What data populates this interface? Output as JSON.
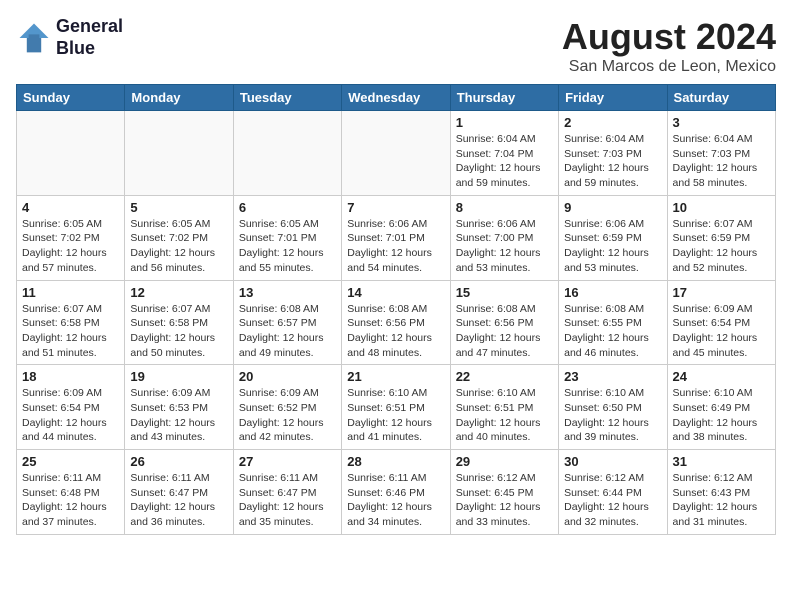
{
  "logo": {
    "line1": "General",
    "line2": "Blue"
  },
  "title": "August 2024",
  "subtitle": "San Marcos de Leon, Mexico",
  "weekdays": [
    "Sunday",
    "Monday",
    "Tuesday",
    "Wednesday",
    "Thursday",
    "Friday",
    "Saturday"
  ],
  "weeks": [
    [
      {
        "day": "",
        "info": ""
      },
      {
        "day": "",
        "info": ""
      },
      {
        "day": "",
        "info": ""
      },
      {
        "day": "",
        "info": ""
      },
      {
        "day": "1",
        "info": "Sunrise: 6:04 AM\nSunset: 7:04 PM\nDaylight: 12 hours\nand 59 minutes."
      },
      {
        "day": "2",
        "info": "Sunrise: 6:04 AM\nSunset: 7:03 PM\nDaylight: 12 hours\nand 59 minutes."
      },
      {
        "day": "3",
        "info": "Sunrise: 6:04 AM\nSunset: 7:03 PM\nDaylight: 12 hours\nand 58 minutes."
      }
    ],
    [
      {
        "day": "4",
        "info": "Sunrise: 6:05 AM\nSunset: 7:02 PM\nDaylight: 12 hours\nand 57 minutes."
      },
      {
        "day": "5",
        "info": "Sunrise: 6:05 AM\nSunset: 7:02 PM\nDaylight: 12 hours\nand 56 minutes."
      },
      {
        "day": "6",
        "info": "Sunrise: 6:05 AM\nSunset: 7:01 PM\nDaylight: 12 hours\nand 55 minutes."
      },
      {
        "day": "7",
        "info": "Sunrise: 6:06 AM\nSunset: 7:01 PM\nDaylight: 12 hours\nand 54 minutes."
      },
      {
        "day": "8",
        "info": "Sunrise: 6:06 AM\nSunset: 7:00 PM\nDaylight: 12 hours\nand 53 minutes."
      },
      {
        "day": "9",
        "info": "Sunrise: 6:06 AM\nSunset: 6:59 PM\nDaylight: 12 hours\nand 53 minutes."
      },
      {
        "day": "10",
        "info": "Sunrise: 6:07 AM\nSunset: 6:59 PM\nDaylight: 12 hours\nand 52 minutes."
      }
    ],
    [
      {
        "day": "11",
        "info": "Sunrise: 6:07 AM\nSunset: 6:58 PM\nDaylight: 12 hours\nand 51 minutes."
      },
      {
        "day": "12",
        "info": "Sunrise: 6:07 AM\nSunset: 6:58 PM\nDaylight: 12 hours\nand 50 minutes."
      },
      {
        "day": "13",
        "info": "Sunrise: 6:08 AM\nSunset: 6:57 PM\nDaylight: 12 hours\nand 49 minutes."
      },
      {
        "day": "14",
        "info": "Sunrise: 6:08 AM\nSunset: 6:56 PM\nDaylight: 12 hours\nand 48 minutes."
      },
      {
        "day": "15",
        "info": "Sunrise: 6:08 AM\nSunset: 6:56 PM\nDaylight: 12 hours\nand 47 minutes."
      },
      {
        "day": "16",
        "info": "Sunrise: 6:08 AM\nSunset: 6:55 PM\nDaylight: 12 hours\nand 46 minutes."
      },
      {
        "day": "17",
        "info": "Sunrise: 6:09 AM\nSunset: 6:54 PM\nDaylight: 12 hours\nand 45 minutes."
      }
    ],
    [
      {
        "day": "18",
        "info": "Sunrise: 6:09 AM\nSunset: 6:54 PM\nDaylight: 12 hours\nand 44 minutes."
      },
      {
        "day": "19",
        "info": "Sunrise: 6:09 AM\nSunset: 6:53 PM\nDaylight: 12 hours\nand 43 minutes."
      },
      {
        "day": "20",
        "info": "Sunrise: 6:09 AM\nSunset: 6:52 PM\nDaylight: 12 hours\nand 42 minutes."
      },
      {
        "day": "21",
        "info": "Sunrise: 6:10 AM\nSunset: 6:51 PM\nDaylight: 12 hours\nand 41 minutes."
      },
      {
        "day": "22",
        "info": "Sunrise: 6:10 AM\nSunset: 6:51 PM\nDaylight: 12 hours\nand 40 minutes."
      },
      {
        "day": "23",
        "info": "Sunrise: 6:10 AM\nSunset: 6:50 PM\nDaylight: 12 hours\nand 39 minutes."
      },
      {
        "day": "24",
        "info": "Sunrise: 6:10 AM\nSunset: 6:49 PM\nDaylight: 12 hours\nand 38 minutes."
      }
    ],
    [
      {
        "day": "25",
        "info": "Sunrise: 6:11 AM\nSunset: 6:48 PM\nDaylight: 12 hours\nand 37 minutes."
      },
      {
        "day": "26",
        "info": "Sunrise: 6:11 AM\nSunset: 6:47 PM\nDaylight: 12 hours\nand 36 minutes."
      },
      {
        "day": "27",
        "info": "Sunrise: 6:11 AM\nSunset: 6:47 PM\nDaylight: 12 hours\nand 35 minutes."
      },
      {
        "day": "28",
        "info": "Sunrise: 6:11 AM\nSunset: 6:46 PM\nDaylight: 12 hours\nand 34 minutes."
      },
      {
        "day": "29",
        "info": "Sunrise: 6:12 AM\nSunset: 6:45 PM\nDaylight: 12 hours\nand 33 minutes."
      },
      {
        "day": "30",
        "info": "Sunrise: 6:12 AM\nSunset: 6:44 PM\nDaylight: 12 hours\nand 32 minutes."
      },
      {
        "day": "31",
        "info": "Sunrise: 6:12 AM\nSunset: 6:43 PM\nDaylight: 12 hours\nand 31 minutes."
      }
    ]
  ]
}
